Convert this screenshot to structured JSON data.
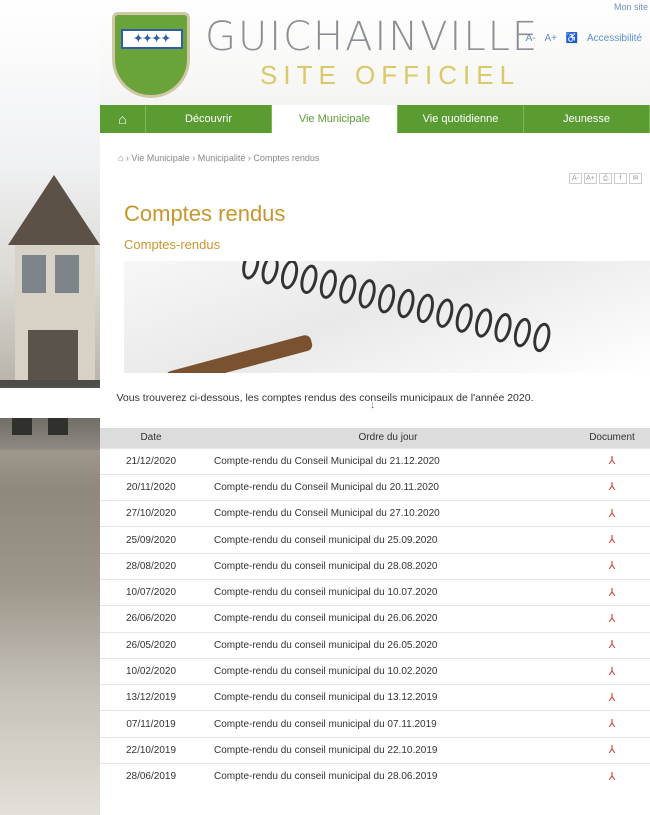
{
  "header": {
    "title": "GUICHAINVILLE",
    "subtitle": "SITE OFFICIEL",
    "crest_text": "✦✦✦✦",
    "tools": [
      "A-",
      "A+",
      "Accessibilité"
    ],
    "toplink": "Mon site"
  },
  "nav": {
    "tabs": [
      "Découvrir",
      "Vie Municipale",
      "Vie quotidienne",
      "Jeunesse"
    ],
    "active_index": 1
  },
  "breadcrumb": "⌂ › Vie Municipale › Municipalité › Comptes rendus",
  "share_icons": [
    "A-",
    "A+",
    "⎙",
    "f",
    "✉"
  ],
  "page": {
    "title": "Comptes rendus",
    "subtitle": "Comptes-rendus",
    "intro": "Vous trouverez ci-dessous, les comptes rendus des conseils municipaux de l'année 2020.",
    "arrow": "↓"
  },
  "table": {
    "headers": [
      "Date",
      "Ordre du jour",
      "Document"
    ],
    "rows": [
      {
        "date": "21/12/2020",
        "title": "Compte-rendu du Conseil Municipal du 21.12.2020"
      },
      {
        "date": "20/11/2020",
        "title": "Compte-rendu du Conseil Municipal du 20.11.2020"
      },
      {
        "date": "27/10/2020",
        "title": "Compte-rendu du Conseil Municipal du 27.10.2020"
      },
      {
        "date": "25/09/2020",
        "title": "Compte-rendu du conseil municipal du 25.09.2020"
      },
      {
        "date": "28/08/2020",
        "title": "Compte-rendu du conseil municipal du 28.08.2020"
      },
      {
        "date": "10/07/2020",
        "title": "Compte-rendu du conseil municipal du 10.07.2020"
      },
      {
        "date": "26/06/2020",
        "title": "Compte-rendu du conseil municipal du 26.06.2020"
      },
      {
        "date": "26/05/2020",
        "title": "Compte-rendu du conseil municipal du 26.05.2020"
      },
      {
        "date": "10/02/2020",
        "title": "Compte-rendu du conseil municipal du 10.02.2020"
      },
      {
        "date": "13/12/2019",
        "title": "Compte-rendu du conseil municipal du 13.12.2019"
      },
      {
        "date": "07/11/2019",
        "title": "Compte-rendu du conseil municipal du 07.11.2019"
      },
      {
        "date": "22/10/2019",
        "title": "Compte-rendu du conseil municipal du 22.10.2019"
      },
      {
        "date": "28/06/2019",
        "title": "Compte-rendu du conseil municipal du 28.06.2019"
      }
    ],
    "doc_icon": "pdf-icon"
  },
  "colors": {
    "nav_green": "#5a9b32",
    "title_gold": "#c8962e",
    "pdf_red": "#d03a2e"
  }
}
